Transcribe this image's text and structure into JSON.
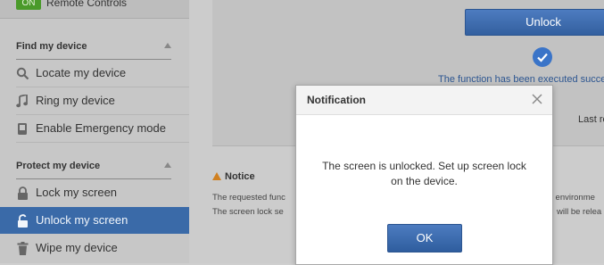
{
  "sidebar": {
    "remote_controls": {
      "badge": "ON",
      "label": "Remote Controls"
    },
    "sections": [
      {
        "title": "Find my device"
      },
      {
        "title": "Protect my device"
      }
    ],
    "items": [
      {
        "label": "Locate my device",
        "icon": "search-icon"
      },
      {
        "label": "Ring my device",
        "icon": "music-note-icon"
      },
      {
        "label": "Enable Emergency mode",
        "icon": "emergency-icon"
      },
      {
        "label": "Lock my screen",
        "icon": "lock-icon"
      },
      {
        "label": "Unlock my screen",
        "icon": "unlock-icon"
      },
      {
        "label": "Wipe my device",
        "icon": "trash-icon"
      }
    ]
  },
  "main": {
    "unlock_button": "Unlock",
    "success_text": "The function has been executed successf",
    "last_request": "Last reque",
    "notice": {
      "title": "Notice",
      "line1_left": "The requested func",
      "line1_right": "rk environme",
      "line2_left": "The screen lock se",
      "line2_right": "will be relea"
    }
  },
  "dialog": {
    "title": "Notification",
    "message_line1": "The screen is unlocked. Set up screen lock",
    "message_line2": "on the device.",
    "ok_label": "OK"
  },
  "colors": {
    "accent": "#3a6aa8",
    "on_badge": "#4a9a2a",
    "warning": "#d08020"
  }
}
